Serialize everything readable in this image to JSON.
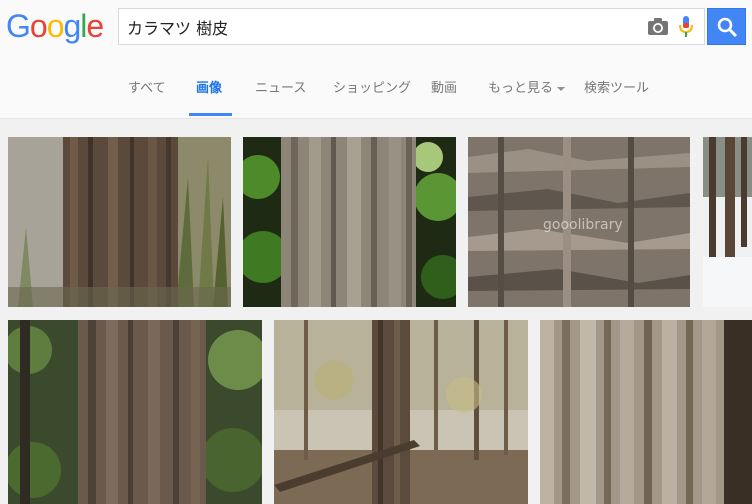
{
  "logo": {
    "letters": [
      "G",
      "o",
      "o",
      "g",
      "l",
      "e"
    ],
    "colors": [
      "#4285f4",
      "#ea4335",
      "#fbbc05",
      "#4285f4",
      "#34a853",
      "#ea4335"
    ]
  },
  "search": {
    "query": "カラマツ 樹皮",
    "camera_icon": "camera-icon",
    "mic_icon": "microphone-icon",
    "button_icon": "magnifier-icon"
  },
  "tabs": [
    {
      "label": "すべて"
    },
    {
      "label": "画像",
      "active": true
    },
    {
      "label": "ニュース"
    },
    {
      "label": "ショッピング"
    },
    {
      "label": "動画"
    },
    {
      "label": "もっと見る",
      "dropdown": true
    },
    {
      "label": "検索ツール"
    }
  ],
  "results": {
    "row1": [
      {
        "subject": "larch trunk among bamboo"
      },
      {
        "subject": "larch trunk with green foliage"
      },
      {
        "subject": "close-up larch bark",
        "watermark": "gooolibrary"
      },
      {
        "subject": "trunks in snow"
      }
    ],
    "row2": [
      {
        "subject": "larch trunk with ivy"
      },
      {
        "subject": "larch forest with fallen log"
      },
      {
        "subject": "close-up bark texture"
      }
    ]
  },
  "colors": {
    "accent": "#4285f4",
    "tab_text": "#777777",
    "header_bg": "#fafafa",
    "page_bg": "#f1f1f1"
  }
}
